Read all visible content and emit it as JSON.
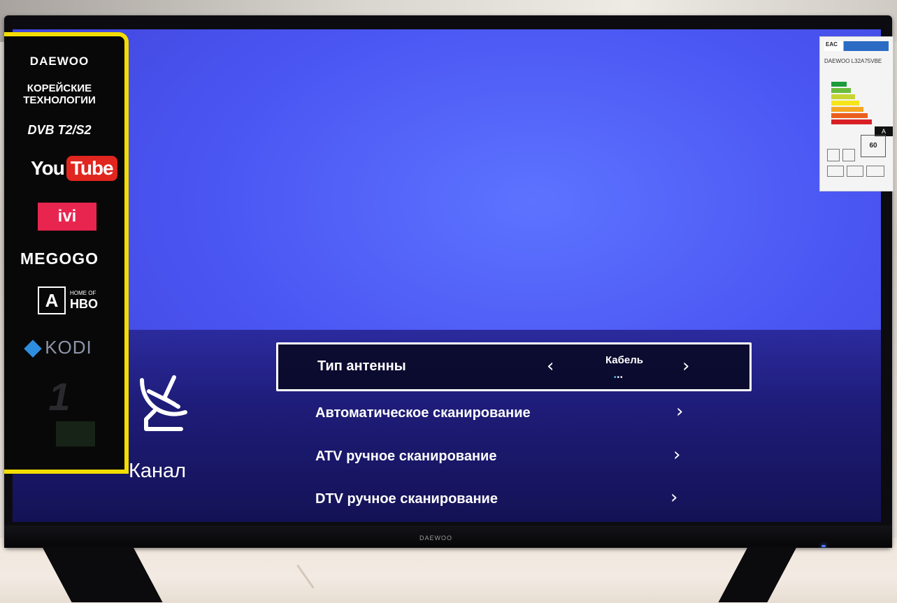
{
  "sticker": {
    "brand": "DAEWOO",
    "tagline_line1": "КОРЕЙСКИЕ",
    "tagline_line2": "ТЕХНОЛОГИИ",
    "dvb": "DVB T2/S2",
    "youtube_you": "You",
    "youtube_tube": "Tube",
    "ivi": "ivi",
    "megogo": "MEGOGO",
    "amediateka_letter": "A",
    "hbo_home": "HOME OF",
    "hbo": "HBO",
    "kodi": "KODI",
    "channel_one": "1"
  },
  "energy_label": {
    "eac": "EAC",
    "brand_model": "DAEWOO L32A75VBE",
    "class": "A",
    "power": "60",
    "bar_colors": [
      "#1c9b3a",
      "#6abd3c",
      "#c7d531",
      "#f6e51a",
      "#f5a623",
      "#ea5f1e",
      "#d81f26"
    ]
  },
  "menu": {
    "section_title": "Канал",
    "section_icon": "satellite-dish-icon",
    "items": [
      {
        "label": "Тип антенны",
        "value": "Кабель",
        "focused": true
      },
      {
        "label": "Автоматическое сканирование"
      },
      {
        "label": "ATV ручное сканирование"
      },
      {
        "label": "DTV ручное сканирование"
      }
    ]
  },
  "tv": {
    "bezel_brand": "DAEWOO"
  },
  "colors": {
    "screen_blue": "#4a55f2",
    "sticker_yellow": "#f3dd00",
    "youtube_red": "#e0261f",
    "ivi_pink": "#e8254f"
  }
}
